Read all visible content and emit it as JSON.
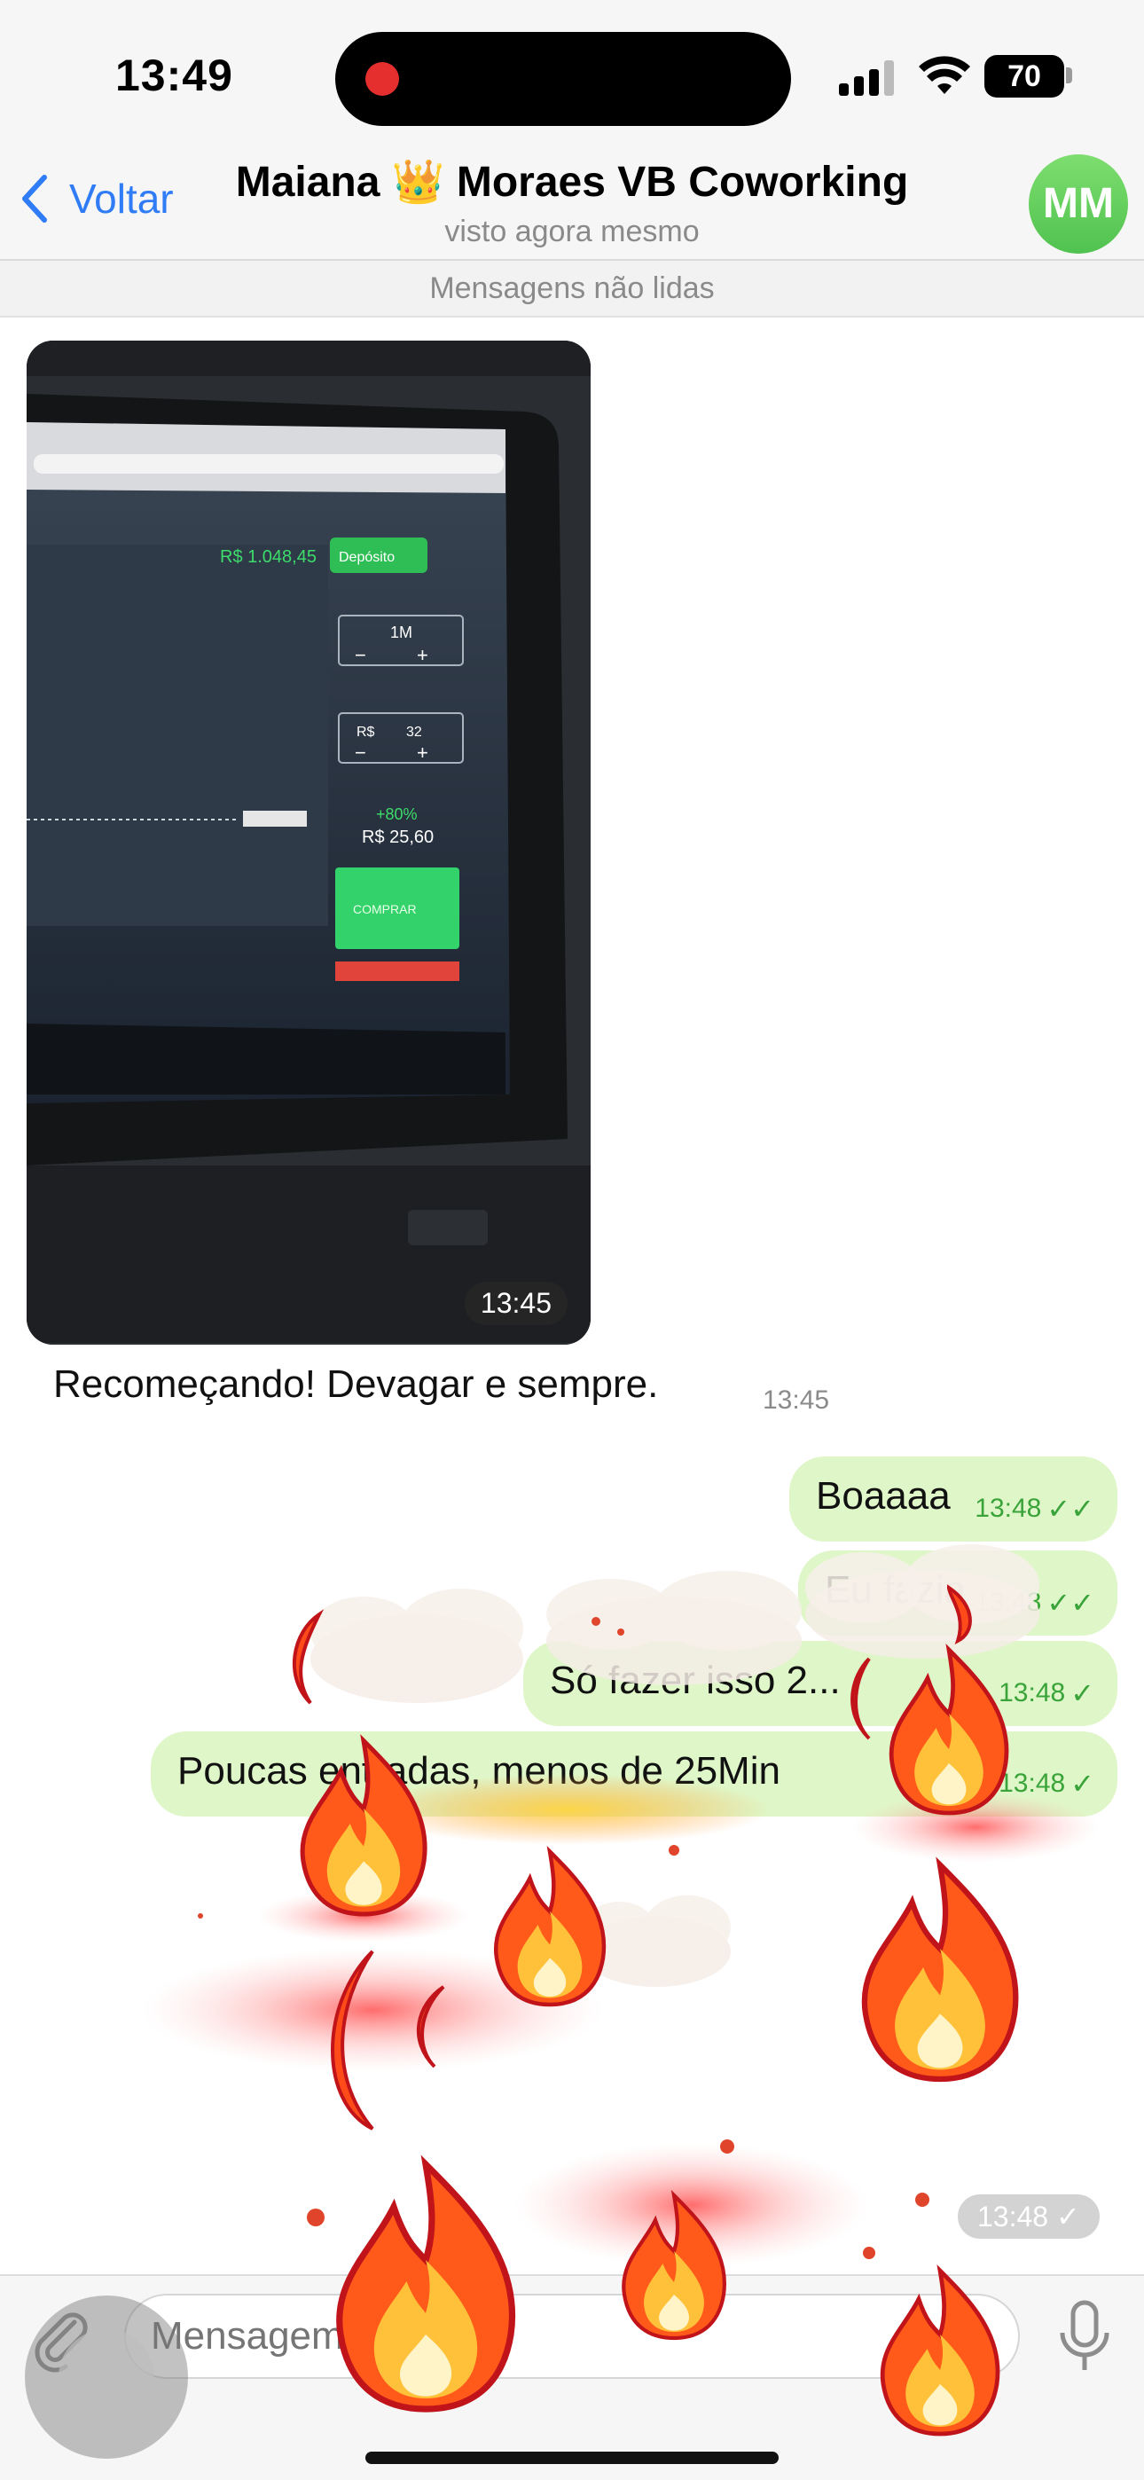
{
  "status_bar": {
    "time": "13:49",
    "battery": "70"
  },
  "header": {
    "back_label": "Voltar",
    "contact_name": "Maiana 👑 Moraes VB Coworking",
    "contact_status": "visto agora mesmo",
    "avatar_initials": "MM"
  },
  "chat": {
    "unread_divider": "Mensagens não lidas",
    "photo_message": {
      "time": "13:45",
      "screen": {
        "balance": "R$ 1.048,45",
        "deposit_label": "Depósito",
        "duration": "1M",
        "amount_currency": "R$",
        "amount": "32",
        "profit_pct": "+80%",
        "profit_value": "R$ 25,60",
        "buy_label": "COMPRAR"
      }
    },
    "incoming": {
      "text": "Recomeçando! Devagar e sempre.",
      "time": "13:45"
    },
    "outgoing": [
      {
        "text": "Boaaaa",
        "time": "13:48",
        "read": true
      },
      {
        "text": "Eu fazia",
        "time": "13:48",
        "read": true
      },
      {
        "text": "Só fazer isso 2...",
        "time": "13:48",
        "read": false
      },
      {
        "text": "Poucas entradas, menos de 25Min",
        "time": "13:48",
        "read": false
      }
    ],
    "effect_time": "13:48"
  },
  "composer": {
    "placeholder": "Mensagem"
  },
  "colors": {
    "accent": "#2f7cf6",
    "outgoing_bubble": "#dff7c8",
    "avatar": "#4fc24f"
  }
}
